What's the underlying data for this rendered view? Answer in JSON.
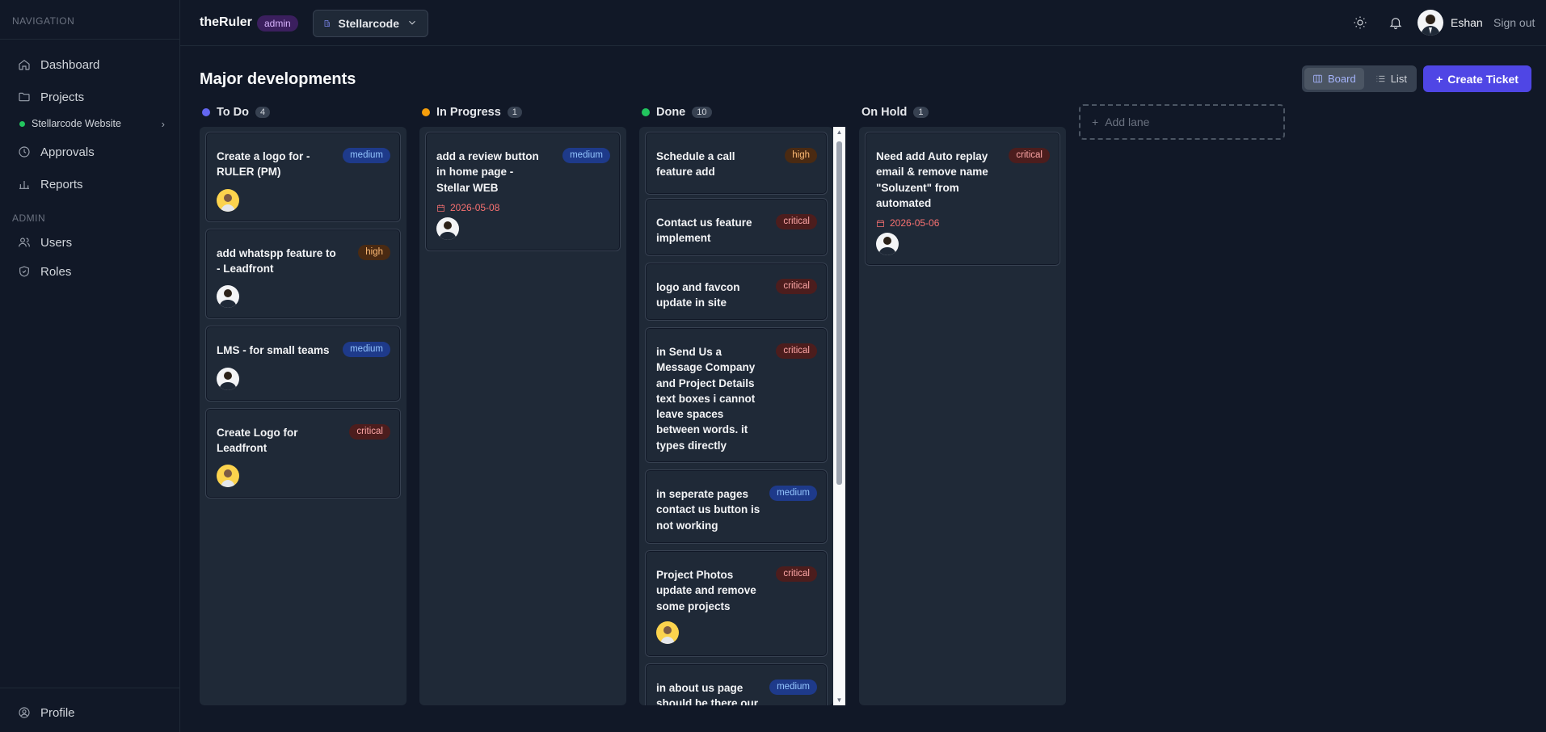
{
  "sidebar": {
    "nav_heading": "NAVIGATION",
    "items": [
      {
        "label": "Dashboard",
        "icon": "home-icon"
      },
      {
        "label": "Projects",
        "icon": "folder-icon"
      },
      {
        "label": "Approvals",
        "icon": "clock-icon"
      },
      {
        "label": "Reports",
        "icon": "bar-chart-icon"
      }
    ],
    "sub_project": {
      "label": "Stellarcode Website",
      "status_color": "#22c55e"
    },
    "admin_heading": "ADMIN",
    "admin_items": [
      {
        "label": "Users",
        "icon": "users-icon"
      },
      {
        "label": "Roles",
        "icon": "shield-icon"
      }
    ],
    "profile_label": "Profile"
  },
  "header": {
    "brand": "theRuler",
    "role_badge": "admin",
    "workspace": "Stellarcode",
    "user_name": "Eshan",
    "signout": "Sign out"
  },
  "main": {
    "title": "Major developments",
    "view_board": "Board",
    "view_list": "List",
    "create_label": "Create Ticket",
    "add_lane": "Add lane",
    "accent": "#4f46e5"
  },
  "lanes": [
    {
      "name": "To Do",
      "count": "4",
      "color": "#6366f1",
      "cards": [
        {
          "title": "Create a logo for - RULER (PM)",
          "priority": "medium",
          "avatar": "yellow"
        },
        {
          "title": "add whatspp feature to - Leadfront",
          "priority": "high",
          "avatar": "dark"
        },
        {
          "title": "LMS - for small teams",
          "priority": "medium",
          "avatar": "dark"
        },
        {
          "title": "Create Logo for Leadfront",
          "priority": "critical",
          "avatar": "yellow"
        }
      ]
    },
    {
      "name": "In Progress",
      "count": "1",
      "color": "#f59e0b",
      "cards": [
        {
          "title": "add a review button in home page - Stellar WEB",
          "priority": "medium",
          "due": "2026-05-08",
          "avatar": "dark"
        }
      ]
    },
    {
      "name": "Done",
      "count": "10",
      "color": "#22c55e",
      "cards": [
        {
          "title": "Schedule a call feature add",
          "priority": "high"
        },
        {
          "title": "Contact us feature implement",
          "priority": "critical"
        },
        {
          "title": "logo and favcon update in site",
          "priority": "critical"
        },
        {
          "title": "in Send Us a Message Company and Project Details text boxes i cannot leave spaces between words. it types directly",
          "priority": "critical"
        },
        {
          "title": "in seperate pages contact us button is not working",
          "priority": "medium"
        },
        {
          "title": "Project Photos update and remove some projects",
          "priority": "critical",
          "avatar": "yellow"
        },
        {
          "title": "in about us page should be there our",
          "priority": "medium"
        }
      ]
    },
    {
      "name": "On Hold",
      "count": "1",
      "color": "#6b7280",
      "cards": [
        {
          "title": "Need add Auto replay email & remove name \"Soluzent\" from automated",
          "priority": "critical",
          "due": "2026-05-06",
          "avatar": "dark"
        }
      ]
    }
  ]
}
